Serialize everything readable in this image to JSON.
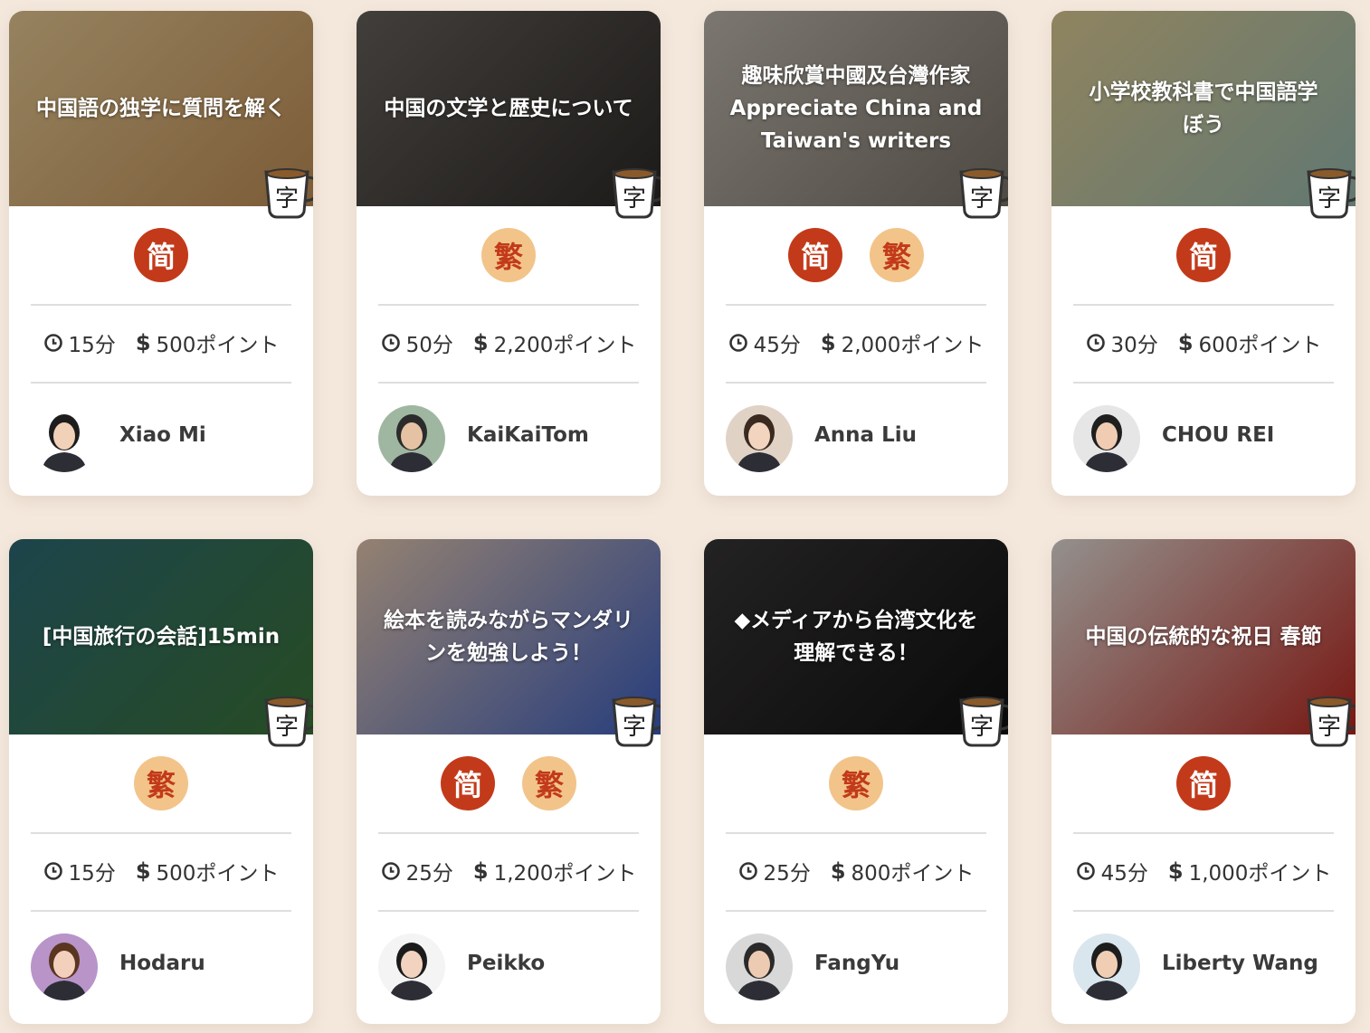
{
  "colors": {
    "page_bg": "#f4e8dd",
    "simplified_badge": "#c23a1a",
    "traditional_badge": "#f2c48a"
  },
  "cards": [
    {
      "title": "中国語の独学に質問を解く",
      "badges": [
        {
          "kind": "simp",
          "label": "简"
        }
      ],
      "duration": "15分",
      "price": "500ポイント",
      "teacher": "Xiao Mi",
      "theme": [
        "#f2d39a",
        "#c9955a"
      ]
    },
    {
      "title": "中国の文学と歴史について",
      "badges": [
        {
          "kind": "trad",
          "label": "繁"
        }
      ],
      "duration": "50分",
      "price": "2,200ポイント",
      "teacher": "KaiKaiTom",
      "theme": [
        "#6a6560",
        "#2e2b28"
      ]
    },
    {
      "title": "趣味欣賞中國及台灣作家\nAppreciate China and\nTaiwan's writers",
      "badges": [
        {
          "kind": "simp",
          "label": "简"
        },
        {
          "kind": "trad",
          "label": "繁"
        }
      ],
      "duration": "45分",
      "price": "2,000ポイント",
      "teacher": "Anna Liu",
      "theme": [
        "#c7c1b6",
        "#7f776c"
      ]
    },
    {
      "title": "小学校教科書で中国語学\nぼう",
      "badges": [
        {
          "kind": "simp",
          "label": "简"
        }
      ],
      "duration": "30分",
      "price": "600ポイント",
      "teacher": "CHOU REI",
      "theme": [
        "#e8d59a",
        "#9fc2b8"
      ]
    },
    {
      "title": "[中国旅行の会話]15min",
      "badges": [
        {
          "kind": "trad",
          "label": "繁"
        }
      ],
      "duration": "15分",
      "price": "500ポイント",
      "teacher": "Hodaru",
      "theme": [
        "#2f6f7a",
        "#3f7a3a"
      ]
    },
    {
      "title": "絵本を読みながらマンダリ\nンを勉強しよう！",
      "badges": [
        {
          "kind": "simp",
          "label": "简"
        },
        {
          "kind": "trad",
          "label": "繁"
        }
      ],
      "duration": "25分",
      "price": "1,200ポイント",
      "teacher": "Peikko",
      "theme": [
        "#f0d2b8",
        "#3f63c9"
      ]
    },
    {
      "title": "◆メディアから台湾文化を\n理解できる！",
      "badges": [
        {
          "kind": "trad",
          "label": "繁"
        }
      ],
      "duration": "25分",
      "price": "800ポイント",
      "teacher": "FangYu",
      "theme": [
        "#3a3838",
        "#111111"
      ]
    },
    {
      "title": "中国の伝統的な祝日 春節",
      "badges": [
        {
          "kind": "simp",
          "label": "简"
        }
      ],
      "duration": "45分",
      "price": "1,000ポイント",
      "teacher": "Liberty Wang",
      "theme": [
        "#eeeae4",
        "#c0261e"
      ]
    }
  ]
}
